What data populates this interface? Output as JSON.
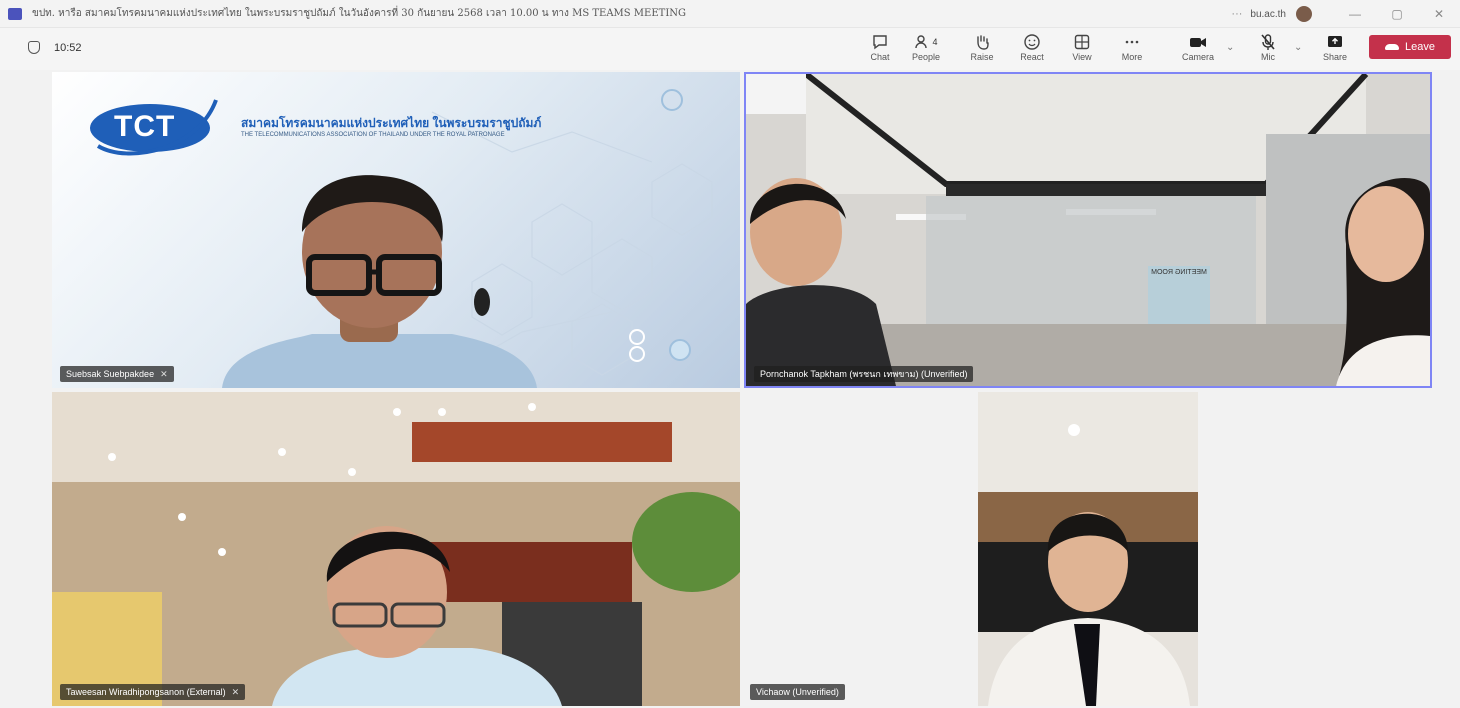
{
  "window": {
    "title": "ขปท. หารือ สมาคมโทรคมนาคมแห่งประเทศไทย ในพระบรมราชูปถัมภ์ ในวันอังคารที่ 30 กันยายน 2568 เวลา 10.00 น ทาง MS TEAMS MEETING",
    "more": "···",
    "org": "bu.ac.th",
    "controls": [
      "—",
      "▢",
      "✕"
    ]
  },
  "meeting": {
    "time": "10:52",
    "toolbar": {
      "chat": "Chat",
      "people": "People",
      "people_count": "4",
      "raise": "Raise",
      "react": "React",
      "view": "View",
      "more": "More",
      "camera": "Camera",
      "mic": "Mic",
      "share": "Share",
      "leave": "Leave"
    }
  },
  "tiles": [
    {
      "name": "Suebsak Suebpakdee",
      "mic_muted": true,
      "logo_text": "TCT",
      "org_th": "สมาคมโทรคมนาคมแห่งประเทศไทย ในพระบรมราชูปถัมภ์",
      "org_en": "THE TELECOMMUNICATIONS ASSOCIATION OF THAILAND UNDER THE ROYAL PATRONAGE"
    },
    {
      "name": "Pornchanok Tapkham (พรชนก เทพขาม) (Unverified)",
      "mic_muted": false,
      "active_speaker": true,
      "sign_text": "MEETING ROOM"
    },
    {
      "name": "Taweesan Wiradhipongsanon (External)",
      "mic_muted": true
    },
    {
      "name": "Vichaow (Unverified)",
      "mic_muted": false
    }
  ],
  "colors": {
    "leave": "#c4314b",
    "active_border": "#7f85f5",
    "tct_blue": "#1f5fb8"
  }
}
